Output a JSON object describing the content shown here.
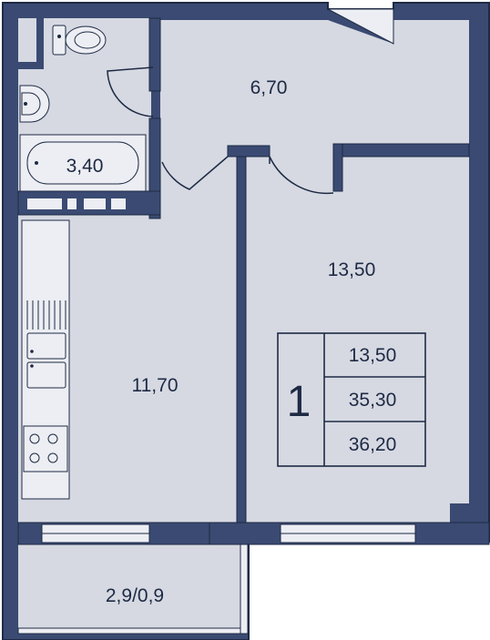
{
  "colors": {
    "wall": "#3a4a72",
    "wall_outline": "#1e2a44",
    "floor": "#d6d9e2",
    "fixture": "#eceef3",
    "text": "#1e2a44"
  },
  "rooms": {
    "hall_area": "6,70",
    "bathroom_area": "3,40",
    "bedroom_area": "13,50",
    "kitchen_area": "11,70",
    "balcony_area": "2,9/0,9"
  },
  "summary": {
    "room_count": "1",
    "living_area": "13,50",
    "total_area": "35,30",
    "total_area_with_balcony": "36,20"
  }
}
